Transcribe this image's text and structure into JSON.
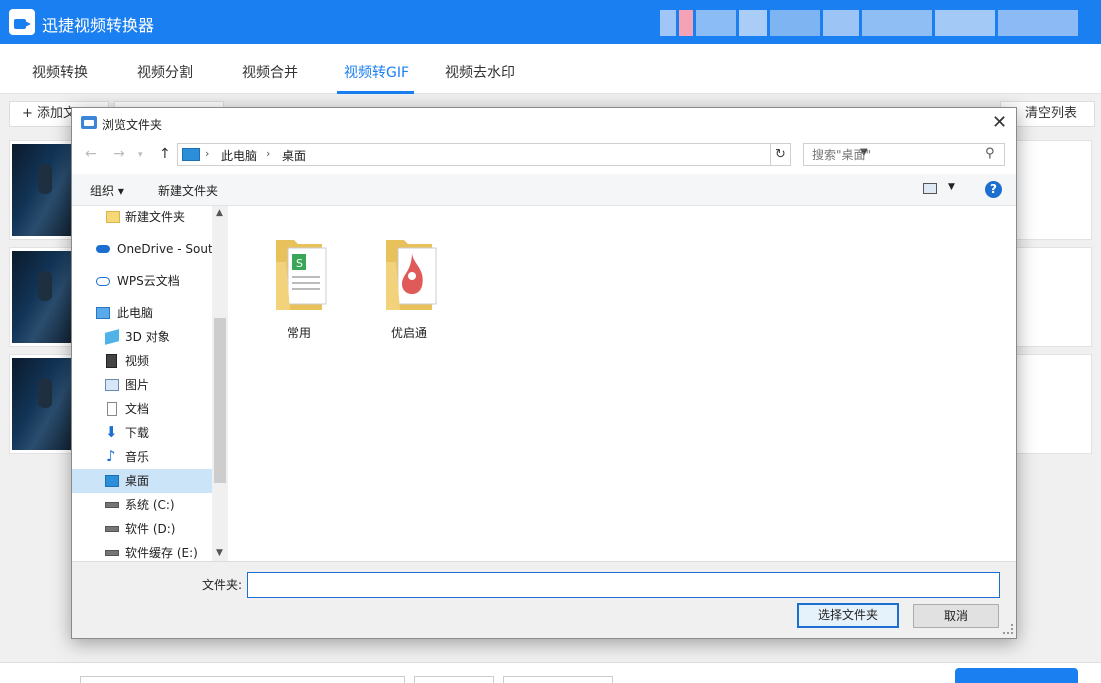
{
  "app": {
    "title": "迅捷视频转换器",
    "accent_color": "#1a7ff0"
  },
  "tabs": [
    {
      "label": "视频转换"
    },
    {
      "label": "视频分割"
    },
    {
      "label": "视频合并"
    },
    {
      "label": "视频转GIF",
      "active": true
    },
    {
      "label": "视频去水印"
    }
  ],
  "toolbar": {
    "add_file_label": "+ 添加文",
    "clear_list_label": "清空列表"
  },
  "dialog": {
    "title": "浏览文件夹",
    "breadcrumb": [
      "此电脑",
      "桌面"
    ],
    "search_placeholder": "搜索\"桌面\"",
    "organize_label": "组织 ▾",
    "new_folder_label": "新建文件夹",
    "help_label": "?",
    "nav_items": [
      {
        "label": "新建文件夹",
        "icon": "folder-icon"
      },
      {
        "label": "OneDrive - Sout",
        "icon": "onedrive-icon"
      },
      {
        "label": "WPS云文档",
        "icon": "cloud-icon"
      },
      {
        "label": "此电脑",
        "icon": "computer-icon"
      },
      {
        "label": "3D 对象",
        "icon": "cube-icon"
      },
      {
        "label": "视频",
        "icon": "video-icon"
      },
      {
        "label": "图片",
        "icon": "picture-icon"
      },
      {
        "label": "文档",
        "icon": "document-icon"
      },
      {
        "label": "下载",
        "icon": "download-icon"
      },
      {
        "label": "音乐",
        "icon": "music-icon"
      },
      {
        "label": "桌面",
        "icon": "desktop-icon",
        "selected": true
      },
      {
        "label": "系统 (C:)",
        "icon": "drive-icon"
      },
      {
        "label": "软件 (D:)",
        "icon": "drive-icon"
      },
      {
        "label": "软件缓存 (E:)",
        "icon": "drive-icon"
      }
    ],
    "folders": [
      {
        "label": "常用",
        "icon": "folder-spreadsheet-icon"
      },
      {
        "label": "优启通",
        "icon": "folder-app-icon"
      }
    ],
    "folder_field_label": "文件夹:",
    "folder_field_value": "",
    "ok_label": "选择文件夹",
    "cancel_label": "取消"
  }
}
